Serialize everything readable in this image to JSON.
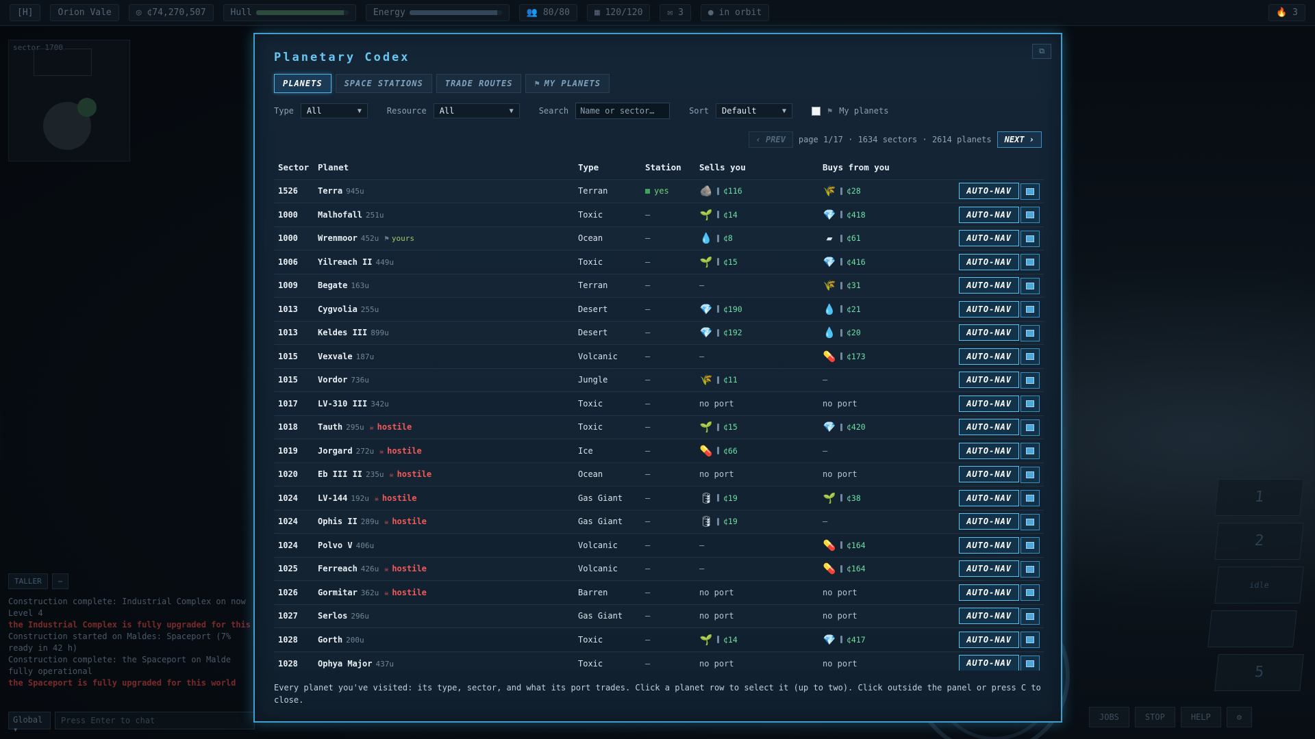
{
  "hud": {
    "home": "[H]",
    "ship": "Orion Vale",
    "credits": "¢74,270,507",
    "hull_label": "Hull",
    "hull_level": 0.95,
    "energy_label": "Energy",
    "energy_level": 0.95,
    "crew": "80/80",
    "cargo": "120/120",
    "mail": "3",
    "status": "in orbit",
    "alerts": "3"
  },
  "minimap": {
    "label": "sector 1700"
  },
  "panel": {
    "title": "Planetary Codex",
    "close_icon": "⧉",
    "tabs": [
      {
        "label": "PLANETS"
      },
      {
        "label": "SPACE STATIONS"
      },
      {
        "label": "TRADE ROUTES"
      },
      {
        "label": "MY PLANETS"
      }
    ],
    "filters": {
      "type_label": "Type",
      "type_value": "All",
      "resource_label": "Resource",
      "resource_value": "All",
      "search_label": "Search",
      "search_placeholder": "Name or sector…",
      "sort_label": "Sort",
      "sort_value": "Default",
      "my_planets_label": "My planets"
    },
    "pager": {
      "prev": "‹ PREV",
      "info": "page 1/17 · 1634 sectors · 2614 planets",
      "next": "NEXT ›"
    },
    "columns": [
      "Sector",
      "Planet",
      "Type",
      "Station",
      "Sells you",
      "Buys from you"
    ],
    "autonav_label": "AUTO-NAV",
    "rows": [
      {
        "sector": "1526",
        "name": "Terra",
        "dist": "945u",
        "tag": "",
        "type": "Terran",
        "station": "yes",
        "sells": {
          "icon": "🪨",
          "price": "¢116"
        },
        "buys": {
          "icon": "🌾",
          "price": "¢28"
        }
      },
      {
        "sector": "1000",
        "name": "Malhofall",
        "dist": "251u",
        "tag": "",
        "type": "Toxic",
        "station": "–",
        "sells": {
          "icon": "🌱",
          "price": "¢14"
        },
        "buys": {
          "icon": "💎",
          "price": "¢418"
        }
      },
      {
        "sector": "1000",
        "name": "Wrenmoor",
        "dist": "452u",
        "tag": "yours",
        "type": "Ocean",
        "station": "–",
        "sells": {
          "icon": "💧",
          "price": "¢8"
        },
        "buys": {
          "icon": "▰",
          "price": "¢61"
        }
      },
      {
        "sector": "1006",
        "name": "Yilreach II",
        "dist": "449u",
        "tag": "",
        "type": "Toxic",
        "station": "–",
        "sells": {
          "icon": "🌱",
          "price": "¢15"
        },
        "buys": {
          "icon": "💎",
          "price": "¢416"
        }
      },
      {
        "sector": "1009",
        "name": "Begate",
        "dist": "163u",
        "tag": "",
        "type": "Terran",
        "station": "–",
        "sells": "–",
        "buys": {
          "icon": "🌾",
          "price": "¢31"
        }
      },
      {
        "sector": "1013",
        "name": "Cygvolia",
        "dist": "255u",
        "tag": "",
        "type": "Desert",
        "station": "–",
        "sells": {
          "icon": "💎",
          "price": "¢190"
        },
        "buys": {
          "icon": "💧",
          "price": "¢21"
        }
      },
      {
        "sector": "1013",
        "name": "Keldes III",
        "dist": "899u",
        "tag": "",
        "type": "Desert",
        "station": "–",
        "sells": {
          "icon": "💎",
          "price": "¢192"
        },
        "buys": {
          "icon": "💧",
          "price": "¢20"
        }
      },
      {
        "sector": "1015",
        "name": "Vexvale",
        "dist": "187u",
        "tag": "",
        "type": "Volcanic",
        "station": "–",
        "sells": "–",
        "buys": {
          "icon": "💊",
          "price": "¢173"
        }
      },
      {
        "sector": "1015",
        "name": "Vordor",
        "dist": "736u",
        "tag": "",
        "type": "Jungle",
        "station": "–",
        "sells": {
          "icon": "🌾",
          "price": "¢11"
        },
        "buys": "–"
      },
      {
        "sector": "1017",
        "name": "LV-310 III",
        "dist": "342u",
        "tag": "",
        "type": "Toxic",
        "station": "–",
        "sells": "no port",
        "buys": "no port"
      },
      {
        "sector": "1018",
        "name": "Tauth",
        "dist": "295u",
        "tag": "hostile",
        "type": "Toxic",
        "station": "–",
        "sells": {
          "icon": "🌱",
          "price": "¢15"
        },
        "buys": {
          "icon": "💎",
          "price": "¢420"
        }
      },
      {
        "sector": "1019",
        "name": "Jorgard",
        "dist": "272u",
        "tag": "hostile",
        "type": "Ice",
        "station": "–",
        "sells": {
          "icon": "💊",
          "price": "¢66"
        },
        "buys": "–"
      },
      {
        "sector": "1020",
        "name": "Eb III II",
        "dist": "235u",
        "tag": "hostile",
        "type": "Ocean",
        "station": "–",
        "sells": "no port",
        "buys": "no port"
      },
      {
        "sector": "1024",
        "name": "LV-144",
        "dist": "192u",
        "tag": "hostile",
        "type": "Gas Giant",
        "station": "–",
        "sells": {
          "icon": "🛢",
          "price": "¢19"
        },
        "buys": {
          "icon": "🌱",
          "price": "¢38"
        }
      },
      {
        "sector": "1024",
        "name": "Ophis II",
        "dist": "289u",
        "tag": "hostile",
        "type": "Gas Giant",
        "station": "–",
        "sells": {
          "icon": "🛢",
          "price": "¢19"
        },
        "buys": "–"
      },
      {
        "sector": "1024",
        "name": "Polvo V",
        "dist": "406u",
        "tag": "",
        "type": "Volcanic",
        "station": "–",
        "sells": "–",
        "buys": {
          "icon": "💊",
          "price": "¢164"
        }
      },
      {
        "sector": "1025",
        "name": "Ferreach",
        "dist": "426u",
        "tag": "hostile",
        "type": "Volcanic",
        "station": "–",
        "sells": "–",
        "buys": {
          "icon": "💊",
          "price": "¢164"
        }
      },
      {
        "sector": "1026",
        "name": "Gormitar",
        "dist": "362u",
        "tag": "hostile",
        "type": "Barren",
        "station": "–",
        "sells": "no port",
        "buys": "no port"
      },
      {
        "sector": "1027",
        "name": "Serlos",
        "dist": "296u",
        "tag": "",
        "type": "Gas Giant",
        "station": "–",
        "sells": "no port",
        "buys": "no port"
      },
      {
        "sector": "1028",
        "name": "Gorth",
        "dist": "200u",
        "tag": "",
        "type": "Toxic",
        "station": "–",
        "sells": {
          "icon": "🌱",
          "price": "¢14"
        },
        "buys": {
          "icon": "💎",
          "price": "¢417"
        }
      },
      {
        "sector": "1028",
        "name": "Ophya Major",
        "dist": "437u",
        "tag": "",
        "type": "Toxic",
        "station": "–",
        "sells": "no port",
        "buys": "no port"
      }
    ],
    "footnote": "Every planet you've visited: its type, sector, and what its port trades. Click a planet row to select it (up to two). Click outside the panel or press C to close."
  },
  "chat": {
    "tab": "TALLER",
    "lines": [
      {
        "text": "Construction complete: Industrial Complex on now Level 4",
        "style": "normal"
      },
      {
        "text": "the Industrial Complex is fully upgraded for this",
        "style": "red"
      },
      {
        "text": "Construction started on Maldes: Spaceport (7% ready in 42 h)",
        "style": "normal"
      },
      {
        "text": "Construction complete: the Spaceport on Malde fully operational",
        "style": "normal"
      },
      {
        "text": "the Spaceport is fully upgraded for this world",
        "style": "red"
      }
    ],
    "channel": "Global",
    "input_placeholder": "Press Enter to chat"
  },
  "slots": [
    "1",
    "2",
    "idle",
    "",
    "5"
  ],
  "bottom_buttons": [
    "JOBS",
    "STOP",
    "HELP",
    "⚙"
  ]
}
